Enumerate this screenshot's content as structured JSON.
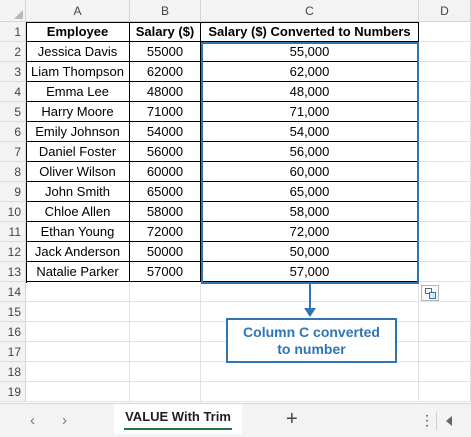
{
  "columns": [
    "A",
    "B",
    "C",
    "D"
  ],
  "rows": [
    "1",
    "2",
    "3",
    "4",
    "5",
    "6",
    "7",
    "8",
    "9",
    "10",
    "11",
    "12",
    "13",
    "14",
    "15",
    "16",
    "17",
    "18",
    "19"
  ],
  "table": {
    "headers": [
      "Employee",
      "Salary ($)",
      "Salary ($) Converted to Numbers"
    ],
    "body": [
      [
        "Jessica Davis",
        "55000",
        "55,000"
      ],
      [
        "Liam Thompson",
        "62000",
        "62,000"
      ],
      [
        "Emma Lee",
        "48000",
        "48,000"
      ],
      [
        "Harry Moore",
        "71000",
        "71,000"
      ],
      [
        "Emily Johnson",
        "54000",
        "54,000"
      ],
      [
        "Daniel Foster",
        "56000",
        "56,000"
      ],
      [
        "Oliver Wilson",
        "60000",
        "60,000"
      ],
      [
        "John Smith",
        "65000",
        "65,000"
      ],
      [
        "Chloe Allen",
        "58000",
        "58,000"
      ],
      [
        "Ethan Young",
        "72000",
        "72,000"
      ],
      [
        "Jack Anderson",
        "50000",
        "50,000"
      ],
      [
        "Natalie Parker",
        "57000",
        "57,000"
      ]
    ]
  },
  "annotation": {
    "line1": "Column C converted",
    "line2": "to number",
    "color": "#2f75b5"
  },
  "sheet_tabs": {
    "active": "VALUE With Trim",
    "prev_icon": "‹",
    "next_icon": "›",
    "add_icon": "+",
    "more_icon": "⋮"
  },
  "paste_options_icon": "paste-options-icon"
}
